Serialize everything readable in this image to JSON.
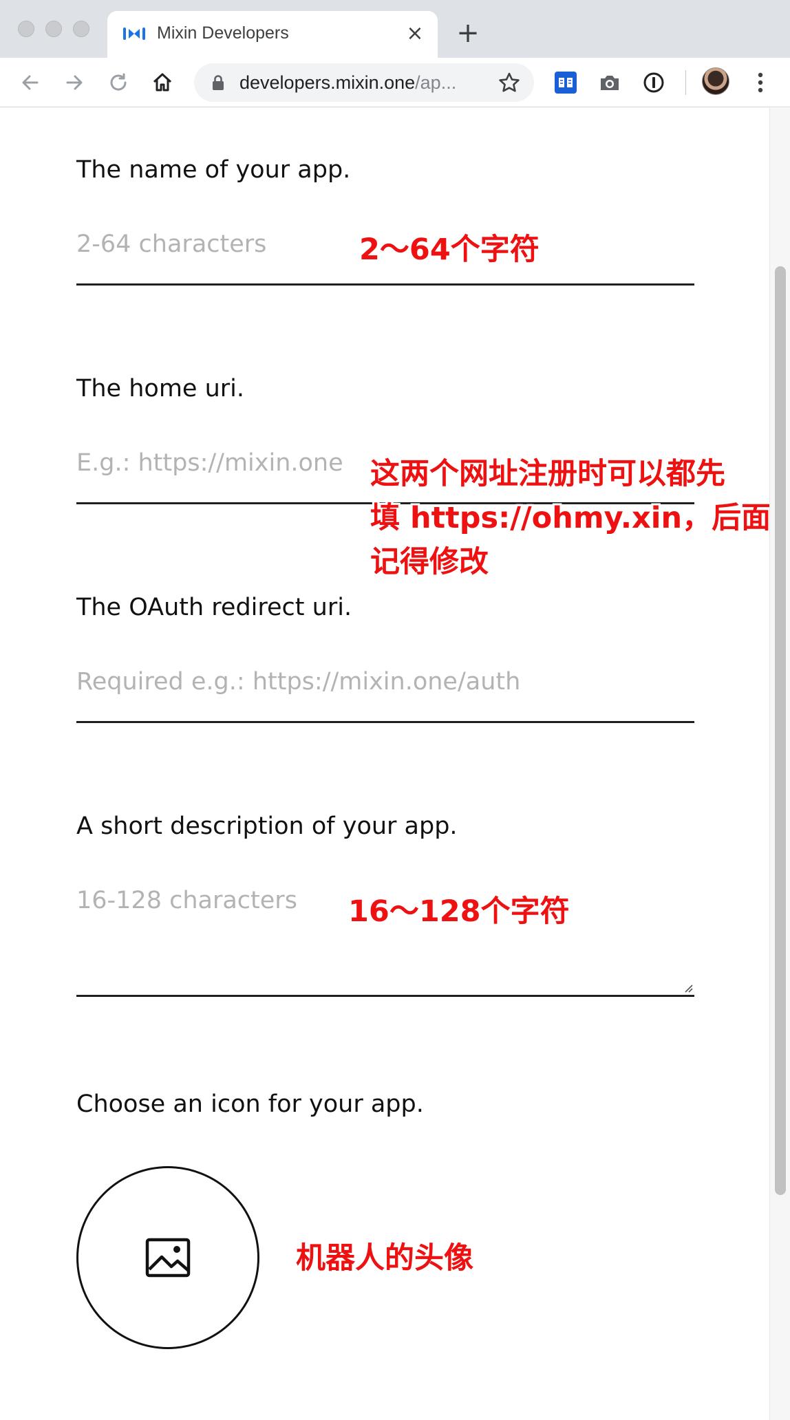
{
  "browser": {
    "tab_title": "Mixin Developers",
    "tab_close_icon": "close-icon",
    "new_tab_icon": "plus-icon",
    "url_host": "developers.mixin.one",
    "url_rest": "/ap...",
    "toolbar_icons": [
      "back-arrow-icon",
      "forward-arrow-icon",
      "reload-icon",
      "home-icon",
      "lock-icon",
      "star-icon",
      "reader-extension-icon",
      "camera-extension-icon",
      "password-extension-icon",
      "profile-avatar",
      "more-menu-icon"
    ]
  },
  "form": {
    "name": {
      "label": "The name of your app.",
      "placeholder": "2-64 characters"
    },
    "home_uri": {
      "label": "The home uri.",
      "placeholder": "E.g.: https://mixin.one"
    },
    "redirect_uri": {
      "label": "The OAuth redirect uri.",
      "placeholder": "Required e.g.: https://mixin.one/auth"
    },
    "description": {
      "label": "A short description of your app.",
      "placeholder": "16-128 characters"
    },
    "icon": {
      "label": "Choose an icon for your app.",
      "icon_name": "image-icon"
    }
  },
  "annotations": {
    "name_note": "2～64个字符",
    "uri_note_line1": "这两个网址注册时可以都先",
    "uri_note_line2": "填 https://ohmy.xin，后面",
    "uri_note_line3": "记得修改",
    "description_note": "16～128个字符",
    "icon_note": "机器人的头像"
  },
  "colors": {
    "annotation_red": "#ee1111",
    "placeholder_gray": "#b3b3b3",
    "tab_bar": "#dee1e6"
  }
}
